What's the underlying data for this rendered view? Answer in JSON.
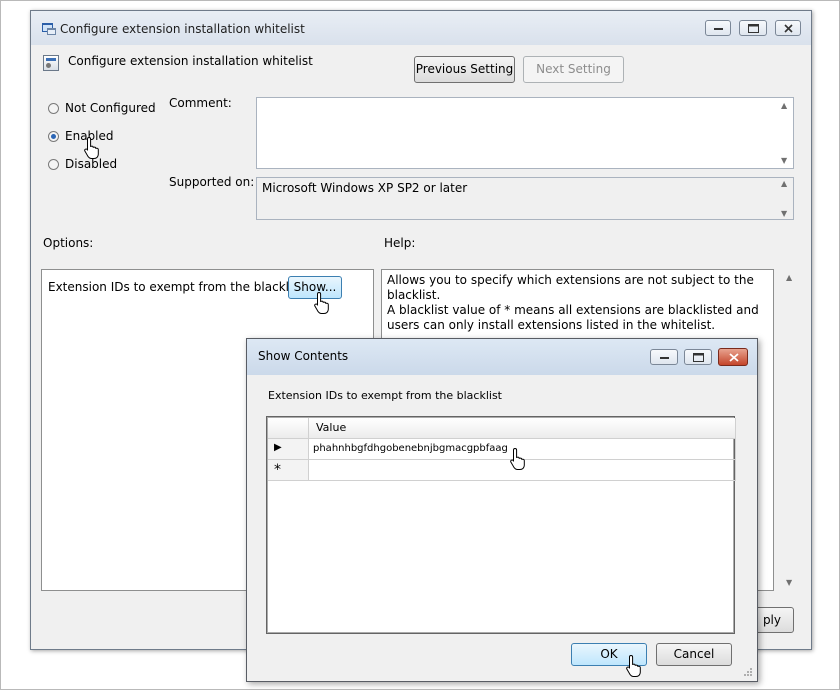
{
  "main_window": {
    "title": "Configure extension installation whitelist",
    "setting_title": "Configure extension installation whitelist",
    "prev_button": "Previous Setting",
    "next_button": "Next Setting",
    "radio_not_configured": "Not Configured",
    "radio_enabled": "Enabled",
    "radio_disabled": "Disabled",
    "selected_state": "Enabled",
    "comment_label": "Comment:",
    "supported_label": "Supported on:",
    "supported_value": "Microsoft Windows XP SP2 or later",
    "options_label": "Options:",
    "help_label": "Help:",
    "option_text": "Extension IDs to exempt from the blacklist",
    "show_button": "Show...",
    "help_paragraph_1": "Allows you to specify which extensions are not subject to the blacklist.",
    "help_paragraph_2": "A blacklist value of * means all extensions are blacklisted and users can only install extensions listed in the whitelist.",
    "apply_button_partial": "ply"
  },
  "dialog": {
    "title": "Show Contents",
    "label": "Extension IDs to exempt from the blacklist",
    "column_header": "Value",
    "rows": [
      {
        "marker": "▶",
        "value": "phahnhbgfdhgobenebnjbgmacgpbfaag"
      },
      {
        "marker": "*",
        "value": ""
      }
    ],
    "ok_button": "OK",
    "cancel_button": "Cancel"
  },
  "icons": [
    "app-window-icon",
    "setting-icon",
    "pointer-hand-icon",
    "minimize-icon",
    "maximize-icon",
    "close-icon"
  ]
}
